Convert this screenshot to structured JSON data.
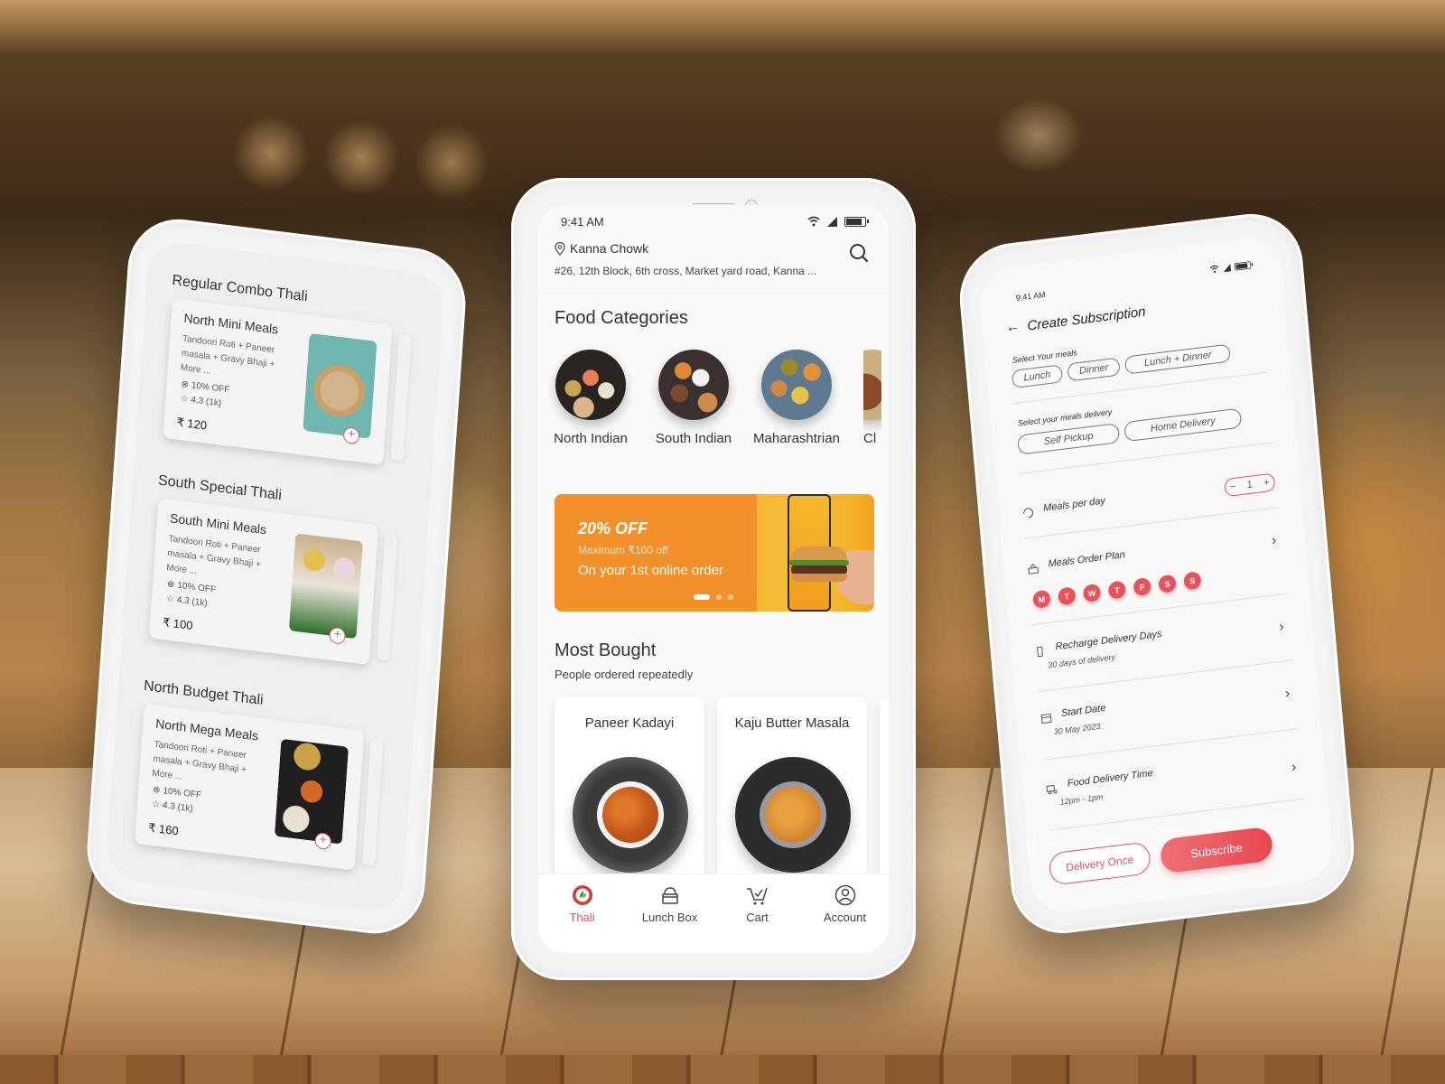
{
  "colors": {
    "accent": "#e8525b",
    "banner_orange": "#f2902a",
    "text": "#333333"
  },
  "center_phone": {
    "status": {
      "time": "9:41 AM",
      "icons": [
        "wifi-icon",
        "signal-icon",
        "battery-icon"
      ]
    },
    "location": {
      "name": "Kanna Chowk",
      "address": "#26, 12th Block, 6th cross, Market yard road, Kanna ..."
    },
    "search_icon": "search-icon",
    "food_categories": {
      "title": "Food Categories",
      "items": [
        {
          "label": "North Indian"
        },
        {
          "label": "South Indian"
        },
        {
          "label": "Maharashtrian"
        },
        {
          "label": "Cl"
        }
      ]
    },
    "banner": {
      "promo": "20% OFF",
      "max": "Maximum ₹100 off",
      "tagline": "On your 1st online order",
      "pages": 3,
      "active_page": 1
    },
    "most_bought": {
      "title": "Most Bought",
      "subtitle": "People ordered repeatedly",
      "items": [
        {
          "name": "Paneer Kadayi"
        },
        {
          "name": "Kaju Butter Masala"
        }
      ]
    },
    "tabs": [
      {
        "label": "Thali",
        "icon": "thali-icon",
        "active": true
      },
      {
        "label": "Lunch Box",
        "icon": "lunch-box-icon",
        "active": false
      },
      {
        "label": "Cart",
        "icon": "cart-icon",
        "active": false
      },
      {
        "label": "Account",
        "icon": "account-icon",
        "active": false
      }
    ]
  },
  "left_phone": {
    "sections": [
      {
        "title": "Regular Combo Thali",
        "card": {
          "name": "North Mini Meals",
          "description": "Tandoori Roti + Paneer masala + Gravy Bhaji + More ...",
          "offer": "10% OFF",
          "rating": "4.3 (1k)",
          "price": "₹ 120"
        }
      },
      {
        "title": "South Special Thali",
        "card": {
          "name": "South Mini Meals",
          "description": "Tandoori Roti + Paneer masala + Gravy Bhaji + More ...",
          "offer": "10% OFF",
          "rating": "4.3 (1k)",
          "price": "₹ 100"
        }
      },
      {
        "title": "North Budget Thali",
        "card": {
          "name": "North Mega Meals",
          "description": "Tandoori Roti + Paneer masala + Gravy Bhaji + More ...",
          "offer": "10% OFF",
          "rating": "4.3 (1k)",
          "price": "₹ 160"
        }
      }
    ]
  },
  "right_phone": {
    "status_time": "9:41 AM",
    "title": "Create Subscription",
    "meals": {
      "label": "Select Your meals",
      "options": [
        "Lunch",
        "Dinner",
        "Lunch + Dinner"
      ]
    },
    "delivery": {
      "label": "Select your meals deilvery",
      "options": [
        "Self Pickup",
        "Home Delivery"
      ]
    },
    "meals_per_day": {
      "label": "Meals per day",
      "value": "1",
      "minus": "−",
      "plus": "+"
    },
    "order_plan": {
      "label": "Meals Order Plan",
      "days": [
        "M",
        "T",
        "W",
        "T",
        "F",
        "S",
        "S"
      ]
    },
    "recharge": {
      "label": "Recharge Delivery Days",
      "sub": "30 days of delivery"
    },
    "start_date": {
      "label": "Start  Date",
      "sub": "30 May 2023"
    },
    "delivery_time": {
      "label": "Food Delivery Time",
      "sub": "12pm - 1pm"
    },
    "buttons": {
      "once": "Delivery Once",
      "subscribe": "Subscribe"
    }
  }
}
